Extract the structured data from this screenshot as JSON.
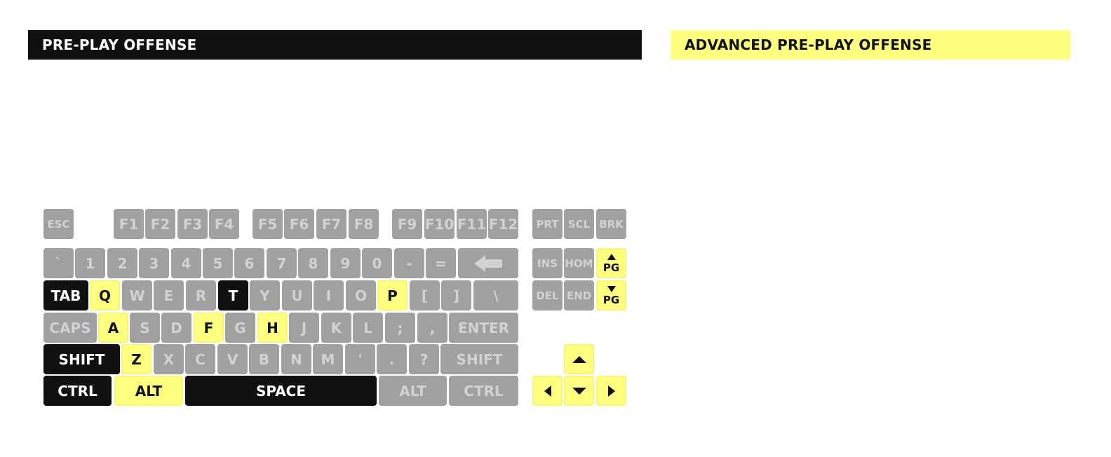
{
  "headers": {
    "left_title": "PRE-PLAY OFFENSE",
    "right_title": "ADVANCED PRE-PLAY OFFENSE"
  },
  "colors": {
    "highlight": "#ffff80",
    "dark": "#111111",
    "inactive": "#a0a0a0"
  },
  "keyboard": {
    "rows": [
      [
        {
          "label": "ESC",
          "state": "off"
        },
        {
          "label": "F1",
          "state": "off"
        },
        {
          "label": "F2",
          "state": "off"
        },
        {
          "label": "F3",
          "state": "off"
        },
        {
          "label": "F4",
          "state": "off"
        },
        {
          "label": "F5",
          "state": "off"
        },
        {
          "label": "F6",
          "state": "off"
        },
        {
          "label": "F7",
          "state": "off"
        },
        {
          "label": "F8",
          "state": "off"
        },
        {
          "label": "F9",
          "state": "off"
        },
        {
          "label": "F10",
          "state": "off"
        },
        {
          "label": "F11",
          "state": "off"
        },
        {
          "label": "F12",
          "state": "off"
        },
        {
          "label": "PRT",
          "state": "off"
        },
        {
          "label": "SCL",
          "state": "off"
        },
        {
          "label": "BRK",
          "state": "off"
        }
      ],
      [
        {
          "label": "`",
          "state": "off"
        },
        {
          "label": "1",
          "state": "off"
        },
        {
          "label": "2",
          "state": "off"
        },
        {
          "label": "3",
          "state": "off"
        },
        {
          "label": "4",
          "state": "off"
        },
        {
          "label": "5",
          "state": "off"
        },
        {
          "label": "6",
          "state": "off"
        },
        {
          "label": "7",
          "state": "off"
        },
        {
          "label": "8",
          "state": "off"
        },
        {
          "label": "9",
          "state": "off"
        },
        {
          "label": "0",
          "state": "off"
        },
        {
          "label": "-",
          "state": "off"
        },
        {
          "label": "=",
          "state": "off"
        },
        {
          "label": "",
          "icon": "backspace-arrow-icon",
          "state": "off"
        },
        {
          "label": "INS",
          "state": "off"
        },
        {
          "label": "HOM",
          "state": "off"
        },
        {
          "label": "PG",
          "icon": "page-up-icon",
          "state": "hi"
        }
      ],
      [
        {
          "label": "TAB",
          "state": "dark"
        },
        {
          "label": "Q",
          "state": "hi"
        },
        {
          "label": "W",
          "state": "off"
        },
        {
          "label": "E",
          "state": "off"
        },
        {
          "label": "R",
          "state": "off"
        },
        {
          "label": "T",
          "state": "dark"
        },
        {
          "label": "Y",
          "state": "off"
        },
        {
          "label": "U",
          "state": "off"
        },
        {
          "label": "I",
          "state": "off"
        },
        {
          "label": "O",
          "state": "off"
        },
        {
          "label": "P",
          "state": "hi"
        },
        {
          "label": "[",
          "state": "off"
        },
        {
          "label": "]",
          "state": "off"
        },
        {
          "label": "\\",
          "state": "off"
        },
        {
          "label": "DEL",
          "state": "off"
        },
        {
          "label": "END",
          "state": "off"
        },
        {
          "label": "PG",
          "icon": "page-down-icon",
          "state": "hi"
        }
      ],
      [
        {
          "label": "CAPS",
          "state": "off"
        },
        {
          "label": "A",
          "state": "hi"
        },
        {
          "label": "S",
          "state": "off"
        },
        {
          "label": "D",
          "state": "off"
        },
        {
          "label": "F",
          "state": "hi"
        },
        {
          "label": "G",
          "state": "off"
        },
        {
          "label": "H",
          "state": "hi"
        },
        {
          "label": "J",
          "state": "off"
        },
        {
          "label": "K",
          "state": "off"
        },
        {
          "label": "L",
          "state": "off"
        },
        {
          "label": ";",
          "state": "off"
        },
        {
          "label": ",",
          "state": "off"
        },
        {
          "label": "ENTER",
          "state": "off"
        }
      ],
      [
        {
          "label": "SHIFT",
          "state": "dark"
        },
        {
          "label": "Z",
          "state": "hi"
        },
        {
          "label": "X",
          "state": "off"
        },
        {
          "label": "C",
          "state": "off"
        },
        {
          "label": "V",
          "state": "off"
        },
        {
          "label": "B",
          "state": "off"
        },
        {
          "label": "N",
          "state": "off"
        },
        {
          "label": "M",
          "state": "off"
        },
        {
          "label": "'",
          "state": "off"
        },
        {
          "label": ".",
          "state": "off"
        },
        {
          "label": "?",
          "state": "off"
        },
        {
          "label": "SHIFT",
          "state": "off"
        },
        {
          "label": "",
          "icon": "arrow-up-icon",
          "state": "hi"
        }
      ],
      [
        {
          "label": "CTRL",
          "state": "dark"
        },
        {
          "label": "ALT",
          "state": "hi"
        },
        {
          "label": "SPACE",
          "state": "dark"
        },
        {
          "label": "ALT",
          "state": "off"
        },
        {
          "label": "CTRL",
          "state": "off"
        },
        {
          "label": "",
          "icon": "arrow-left-icon",
          "state": "hi"
        },
        {
          "label": "",
          "icon": "arrow-down-icon",
          "state": "hi"
        },
        {
          "label": "",
          "icon": "arrow-right-icon",
          "state": "hi"
        }
      ]
    ]
  }
}
